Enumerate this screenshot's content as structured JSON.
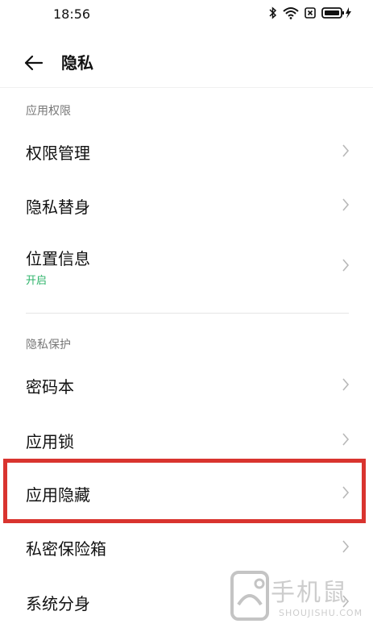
{
  "status_bar": {
    "time": "18:56"
  },
  "header": {
    "title": "隐私"
  },
  "sections": [
    {
      "header": "应用权限",
      "items": [
        {
          "label": "权限管理"
        },
        {
          "label": "隐私替身"
        },
        {
          "label": "位置信息",
          "subtitle": "开启"
        }
      ]
    },
    {
      "header": "隐私保护",
      "items": [
        {
          "label": "密码本"
        },
        {
          "label": "应用锁"
        },
        {
          "label": "应用隐藏"
        },
        {
          "label": "私密保险箱"
        },
        {
          "label": "系统分身"
        }
      ]
    }
  ],
  "colors": {
    "accent_green": "#2db36a",
    "highlight_red": "#d9342f"
  },
  "watermark": {
    "brand_cn": "手机鼠",
    "brand_en": "SHOUJISHU.COM"
  }
}
